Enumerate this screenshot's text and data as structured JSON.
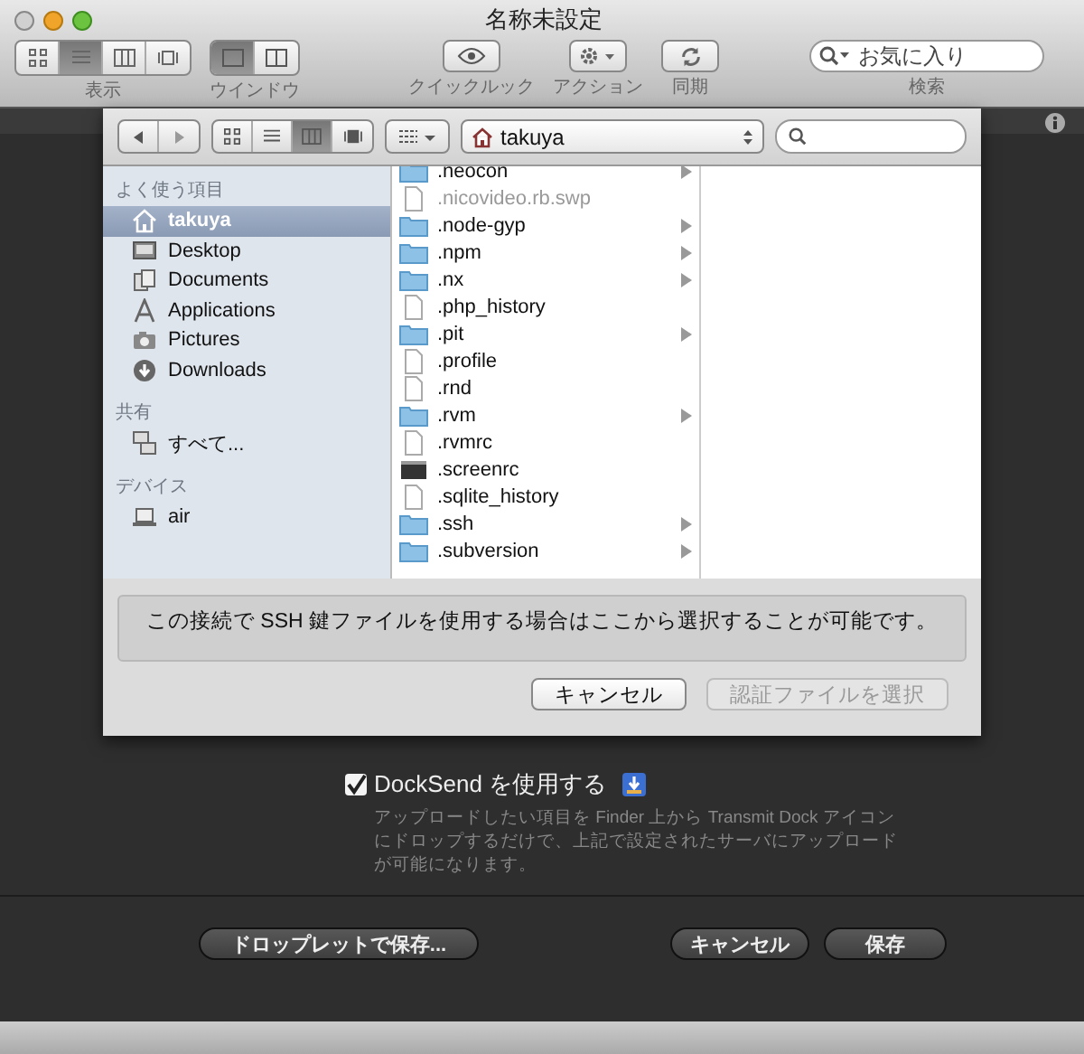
{
  "window": {
    "title": "名称未設定"
  },
  "toolbar": {
    "view_label": "表示",
    "view_modes": [
      {
        "selected": false
      },
      {
        "selected": true
      },
      {
        "selected": false
      },
      {
        "selected": false
      }
    ],
    "window_label": "ウインドウ",
    "window_modes": [
      {
        "selected": true
      },
      {
        "selected": false
      }
    ],
    "quicklook_label": "クイックルック",
    "action_label": "アクション",
    "sync_label": "同期",
    "search": {
      "placeholder": "お気に入り",
      "label": "検索"
    }
  },
  "sheet": {
    "view_modes": [
      {
        "selected": false
      },
      {
        "selected": false
      },
      {
        "selected": true
      },
      {
        "selected": false
      }
    ],
    "path": "takuya",
    "sidebar": [
      {
        "header": "よく使う項目",
        "items": [
          {
            "label": "takuya",
            "kind": "home",
            "selected": true
          },
          {
            "label": "Desktop",
            "kind": "desktop",
            "selected": false
          },
          {
            "label": "Documents",
            "kind": "documents",
            "selected": false
          },
          {
            "label": "Applications",
            "kind": "applications",
            "selected": false
          },
          {
            "label": "Pictures",
            "kind": "pictures",
            "selected": false
          },
          {
            "label": "Downloads",
            "kind": "downloads",
            "selected": false
          }
        ]
      },
      {
        "header": "共有",
        "items": [
          {
            "label": "すべて...",
            "kind": "network",
            "selected": false
          }
        ]
      },
      {
        "header": "デバイス",
        "items": [
          {
            "label": "air",
            "kind": "laptop",
            "selected": false
          }
        ]
      }
    ],
    "files": [
      {
        "name": ".neocon",
        "kind": "folder",
        "expandable": true,
        "disabled": false
      },
      {
        "name": ".nicovideo.rb.swp",
        "kind": "file",
        "expandable": false,
        "disabled": true
      },
      {
        "name": ".node-gyp",
        "kind": "folder",
        "expandable": true,
        "disabled": false
      },
      {
        "name": ".npm",
        "kind": "folder",
        "expandable": true,
        "disabled": false
      },
      {
        "name": ".nx",
        "kind": "folder",
        "expandable": true,
        "disabled": false
      },
      {
        "name": ".php_history",
        "kind": "file",
        "expandable": false,
        "disabled": false
      },
      {
        "name": ".pit",
        "kind": "folder",
        "expandable": true,
        "disabled": false
      },
      {
        "name": ".profile",
        "kind": "file",
        "expandable": false,
        "disabled": false
      },
      {
        "name": ".rnd",
        "kind": "file",
        "expandable": false,
        "disabled": false
      },
      {
        "name": ".rvm",
        "kind": "folder",
        "expandable": true,
        "disabled": false
      },
      {
        "name": ".rvmrc",
        "kind": "file",
        "expandable": false,
        "disabled": false
      },
      {
        "name": ".screenrc",
        "kind": "terminal",
        "expandable": false,
        "disabled": false
      },
      {
        "name": ".sqlite_history",
        "kind": "file",
        "expandable": false,
        "disabled": false
      },
      {
        "name": ".ssh",
        "kind": "folder",
        "expandable": true,
        "disabled": false
      },
      {
        "name": ".subversion",
        "kind": "folder",
        "expandable": true,
        "disabled": false
      }
    ],
    "message": "この接続で SSH 鍵ファイルを使用する場合はここから選択することが可能です。",
    "buttons": [
      {
        "label": "キャンセル",
        "disabled": false
      },
      {
        "label": "認証ファイルを選択",
        "disabled": true
      }
    ]
  },
  "dialog": {
    "docksend": {
      "label": "DockSend を使用する",
      "checked": true,
      "description": "アップロードしたい項目を Finder 上から Transmit Dock アイコンにドロップするだけで、上記で設定されたサーバにアップロードが可能になります。"
    },
    "droplet_button": "ドロップレットで保存...",
    "buttons": [
      "キャンセル",
      "保存"
    ]
  }
}
